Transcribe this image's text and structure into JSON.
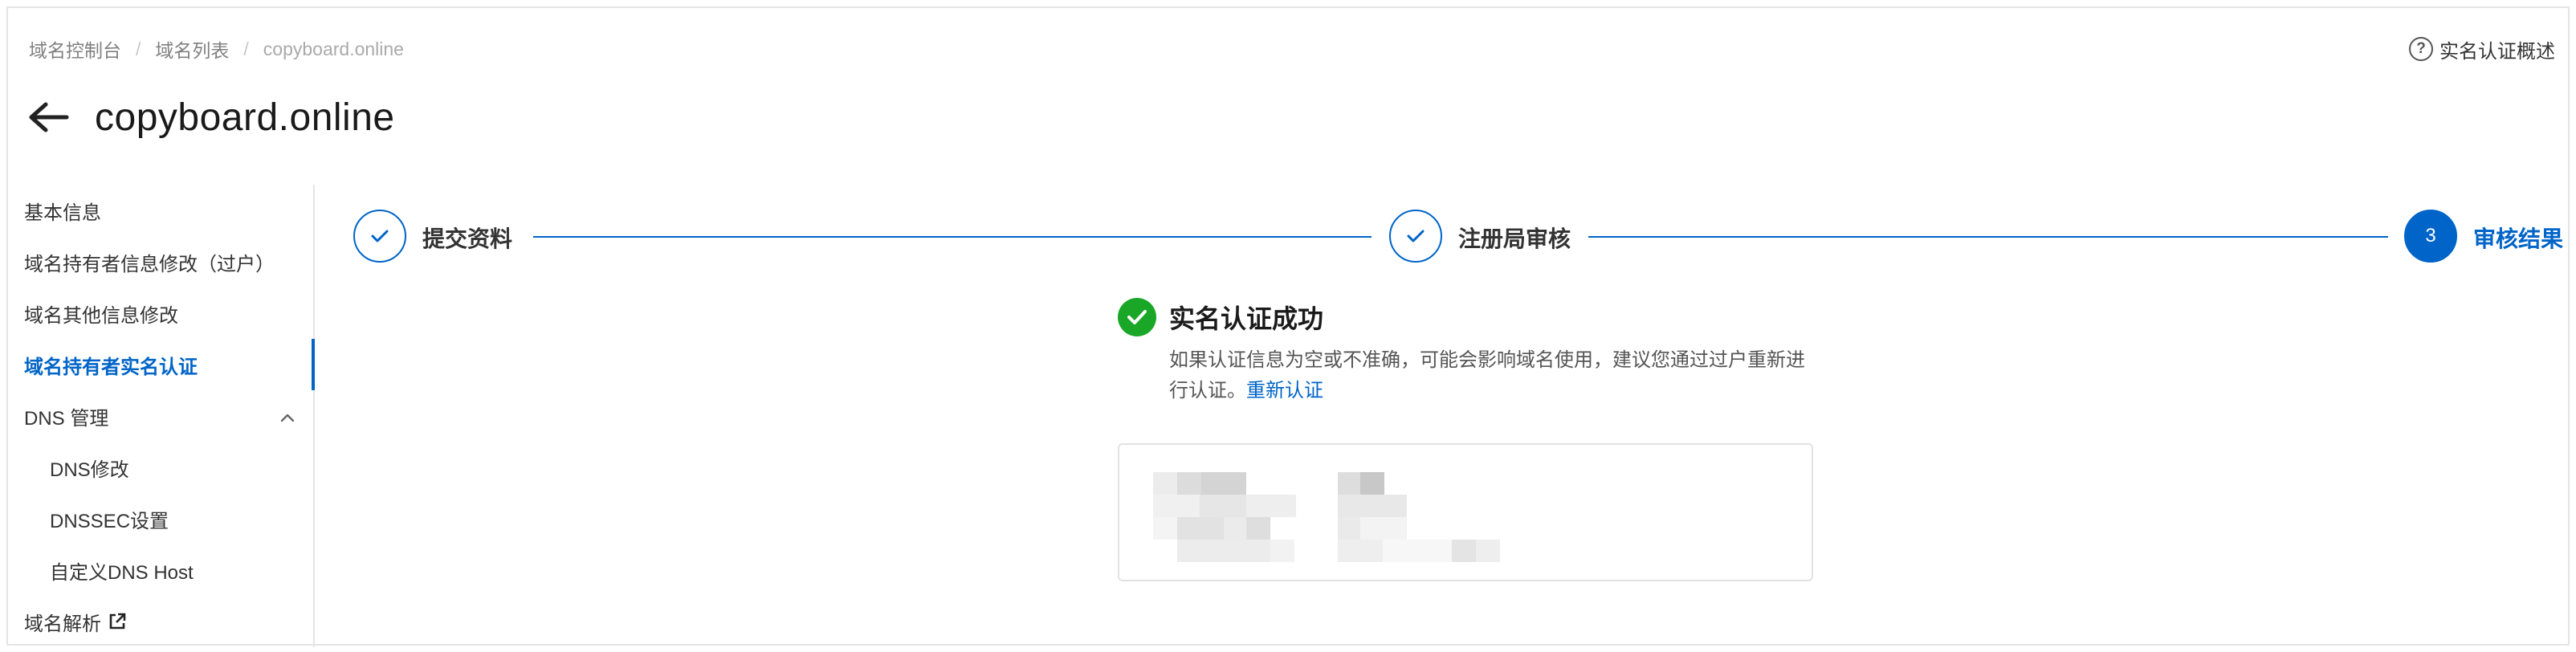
{
  "breadcrumb": [
    "域名控制台",
    "域名列表",
    "copyboard.online"
  ],
  "help": {
    "label": "实名认证概述",
    "icon": "question-circle-icon"
  },
  "title": "copyboard.online",
  "sidebar": {
    "items": [
      {
        "label": "基本信息"
      },
      {
        "label": "域名持有者信息修改（过户）"
      },
      {
        "label": "域名其他信息修改"
      },
      {
        "label": "域名持有者实名认证",
        "active": true
      },
      {
        "label": "DNS 管理",
        "expanded": true
      },
      {
        "label": "DNS修改"
      },
      {
        "label": "DNSSEC设置"
      },
      {
        "label": "自定义DNS Host"
      },
      {
        "label": "域名解析",
        "icon": "external-link-icon"
      }
    ]
  },
  "steps": [
    {
      "label": "提交资料",
      "status": "done"
    },
    {
      "label": "注册局审核",
      "status": "done"
    },
    {
      "number": "3",
      "label": "审核结果",
      "status": "current"
    }
  ],
  "result": {
    "title": "实名认证成功",
    "desc": "如果认证信息为空或不准确，可能会影响域名使用，建议您通过过户重新进行认证。",
    "link": "重新认证"
  },
  "colors": {
    "accent": "#0064c8",
    "success": "#1aa626"
  }
}
